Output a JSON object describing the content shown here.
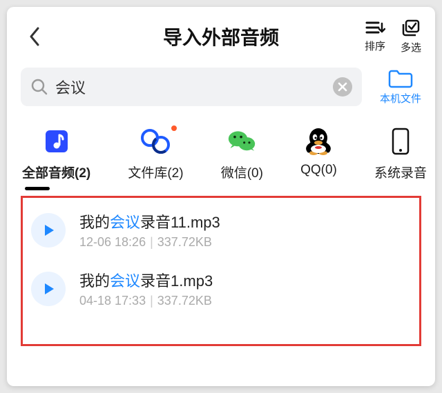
{
  "header": {
    "title": "导入外部音频",
    "sort_label": "排序",
    "multi_label": "多选"
  },
  "search": {
    "query": "会议",
    "placeholder": ""
  },
  "local_files_label": "本机文件",
  "sources": [
    {
      "key": "all",
      "label": "全部音频(2)",
      "active": true
    },
    {
      "key": "lib",
      "label": "文件库(2)",
      "hasDot": true
    },
    {
      "key": "wechat",
      "label": "微信(0)"
    },
    {
      "key": "qq",
      "label": "QQ(0)"
    },
    {
      "key": "sys",
      "label": "系统录音"
    }
  ],
  "highlight": "会议",
  "files": [
    {
      "name_pre": "我的",
      "name_hl": "会议",
      "name_post": "录音11.mp3",
      "date": "12-06 18:26",
      "size": "337.72KB"
    },
    {
      "name_pre": "我的",
      "name_hl": "会议",
      "name_post": "录音1.mp3",
      "date": "04-18 17:33",
      "size": "337.72KB"
    }
  ]
}
